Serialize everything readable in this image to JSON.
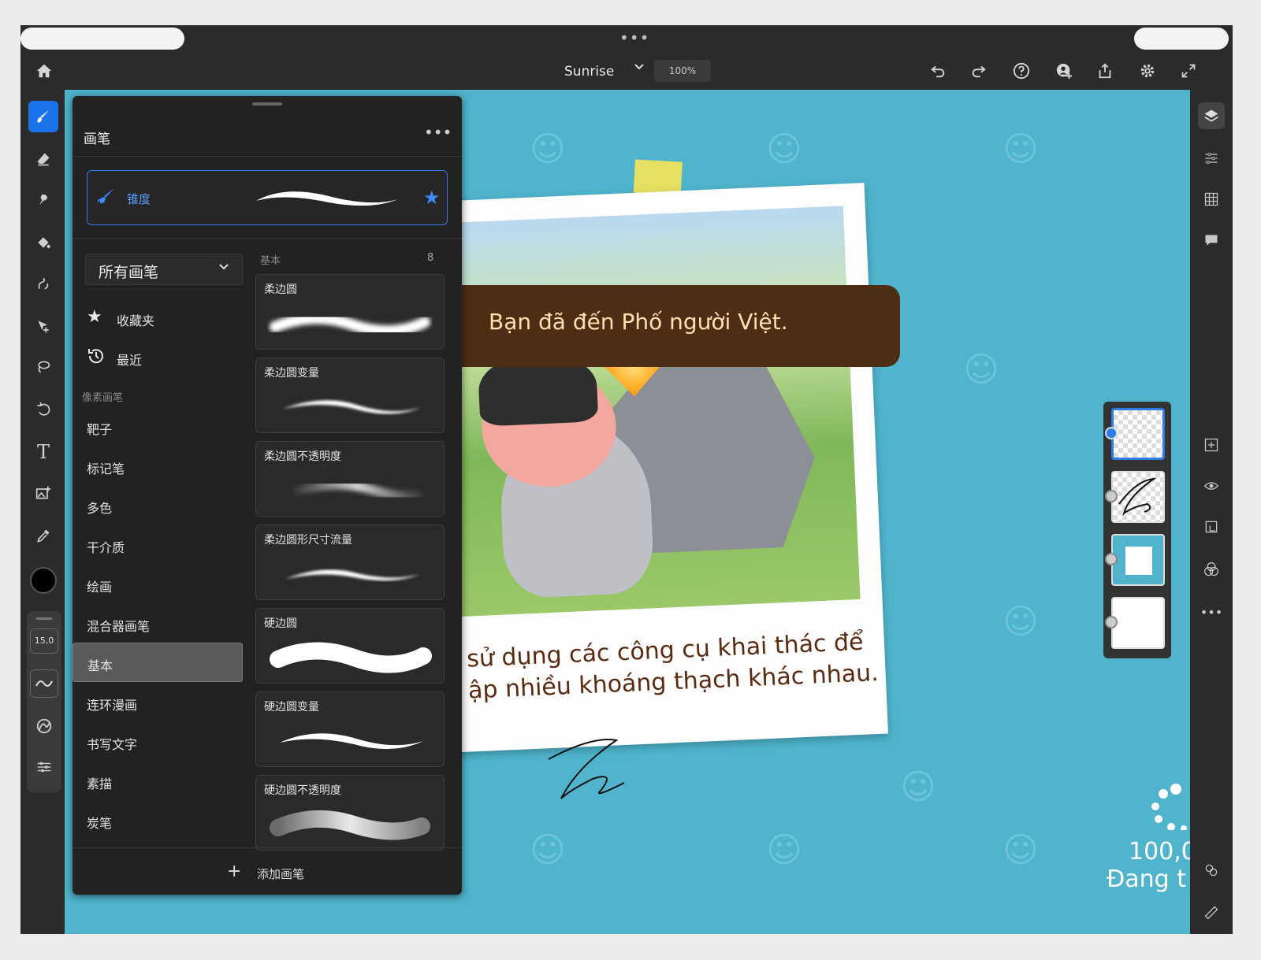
{
  "app": {
    "document_title": "Sunrise",
    "zoom": "100%",
    "top_more": "•••"
  },
  "toolbar_left": {
    "brush_size": "15,0"
  },
  "brush_panel": {
    "title": "画笔",
    "more": "•••",
    "current_brush": {
      "name": "锥度"
    },
    "category_select": "所有画笔",
    "favorites": "收藏夹",
    "recent": "最近",
    "section_pixel": "像素画笔",
    "categories": [
      "靶子",
      "标记笔",
      "多色",
      "干介质",
      "绘画",
      "混合器画笔",
      "基本",
      "连环漫画",
      "书写文字",
      "素描",
      "炭笔"
    ],
    "selected_category": "基本",
    "set_label": "基本",
    "set_count": "8",
    "brushes": [
      "柔边圆",
      "柔边圆变量",
      "柔边圆不透明度",
      "柔边圆形尺寸流量",
      "硬边圆",
      "硬边圆变量",
      "硬边圆不透明度"
    ],
    "add_brush": "添加画笔"
  },
  "canvas": {
    "banner_text": "Bạn đã đến Phố người Việt.",
    "caption_line1": "sử dụng các công cụ khai thác để",
    "caption_line2": "ập nhiều khoáng thạch khác nhau.",
    "progress_value": "100,0",
    "progress_label": "Đang t"
  },
  "colors": {
    "accent": "#1a73e8",
    "canvas_bg": "#4fb4cc",
    "banner_bg": "#4d2d14",
    "banner_text": "#ffe0b0",
    "caption": "#5a2a10"
  }
}
